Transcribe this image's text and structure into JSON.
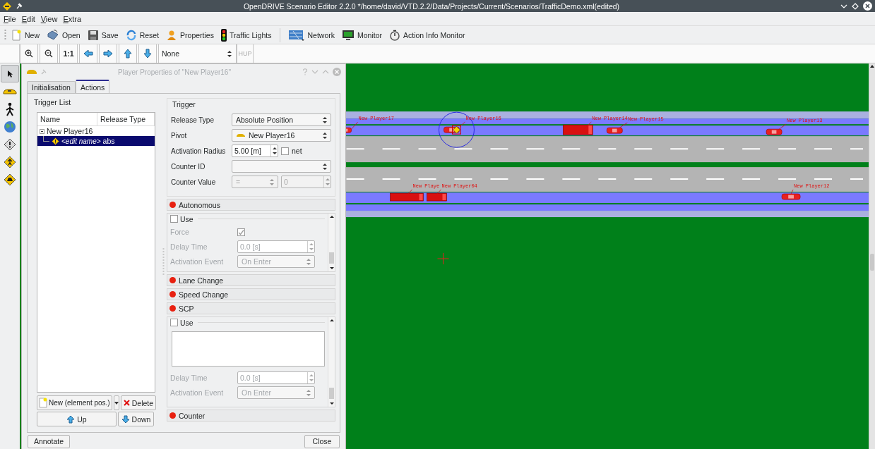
{
  "window": {
    "title": "OpenDRIVE Scenario Editor 2.2.0 */home/david/VTD.2.2/Data/Projects/Current/Scenarios/TrafficDemo.xml(edited)"
  },
  "menu": [
    "File",
    "Edit",
    "View",
    "Extra"
  ],
  "toolbar": [
    {
      "label": "New"
    },
    {
      "label": "Open"
    },
    {
      "label": "Save"
    },
    {
      "label": "Reset"
    },
    {
      "label": "Properties"
    },
    {
      "label": "Traffic Lights"
    },
    {
      "label": "Network"
    },
    {
      "label": "Monitor"
    },
    {
      "label": "Action Info Monitor"
    }
  ],
  "view_toolbar": {
    "scale_label": "1:1",
    "mode": "None",
    "hup": {
      "label": "HUP",
      "disabled": true
    }
  },
  "tools": [
    {
      "selected": true
    },
    {
      "selected": false
    },
    {
      "selected": false
    },
    {
      "selected": false
    },
    {
      "selected": false
    },
    {
      "selected": false
    },
    {
      "selected": false
    }
  ],
  "canvas": {
    "players": [
      {
        "label": "New Player17",
        "kind": "car",
        "selected": false
      },
      {
        "label": "New Player16",
        "kind": "car",
        "selected": true
      },
      {
        "label": "New Player14",
        "kind": "truck",
        "selected": false
      },
      {
        "label": "New Player15",
        "kind": "car",
        "selected": false
      },
      {
        "label": "New Player13",
        "kind": "car",
        "selected": false
      },
      {
        "label": "New Playe",
        "kind": "truck",
        "selected": false
      },
      {
        "label": "New Player04",
        "kind": "truck",
        "selected": false
      },
      {
        "label": "New Player12",
        "kind": "car",
        "selected": false
      }
    ]
  },
  "dialog": {
    "title": "Player Properties of \"New Player16\""
  },
  "tabs": [
    {
      "label": "Initialisation",
      "selected": false
    },
    {
      "label": "Actions",
      "selected": true
    }
  ],
  "trigger_list": {
    "title": "Trigger List",
    "columns": [
      "Name",
      "Release Type"
    ],
    "rows": [
      {
        "name": "New Player16",
        "expanded": true,
        "selected": false,
        "children": [
          {
            "name": "<edit name>",
            "release_type": "abs",
            "selected": true
          }
        ]
      }
    ],
    "buttons": {
      "new": "New (element pos.)",
      "delete": "Delete",
      "up": "Up",
      "down": "Down"
    }
  },
  "trigger": {
    "title": "Trigger",
    "fields": [
      {
        "kind": "combo",
        "label": "Release Type",
        "value": "Absolute Position"
      },
      {
        "kind": "player",
        "label": "Pivot",
        "value": "New Player16"
      },
      {
        "kind": "spin",
        "label": "Activation Radius",
        "value": "5.00 [m]",
        "check": {
          "label": "net",
          "checked": false
        }
      },
      {
        "kind": "combo",
        "label": "Counter ID"
      },
      {
        "kind": "counter",
        "label": "Counter Value",
        "op": "=",
        "value": "0",
        "disabled": true
      }
    ]
  },
  "sections": [
    {
      "title": "Autonomous",
      "expanded": true,
      "use": {
        "label": "Use",
        "checked": false
      },
      "rows": [
        {
          "kind": "checkbox",
          "label": "Force",
          "checked": true
        },
        {
          "kind": "spin",
          "label": "Delay Time",
          "value": "0.0 [s]"
        },
        {
          "kind": "combo",
          "label": "Activation Event",
          "value": "On Enter"
        }
      ]
    },
    {
      "title": "Lane Change",
      "expanded": false
    },
    {
      "title": "Speed Change",
      "expanded": false
    },
    {
      "title": "SCP",
      "expanded": true,
      "use": {
        "label": "Use",
        "checked": false
      },
      "rows": [
        {
          "kind": "textarea"
        },
        {
          "kind": "spin",
          "label": "Delay Time",
          "value": "0.0 [s]"
        },
        {
          "kind": "combo",
          "label": "Activation Event",
          "value": "On Enter"
        }
      ]
    },
    {
      "title": "Counter",
      "expanded": false
    }
  ],
  "footer": {
    "annotate": "Annotate",
    "close": "Close"
  }
}
